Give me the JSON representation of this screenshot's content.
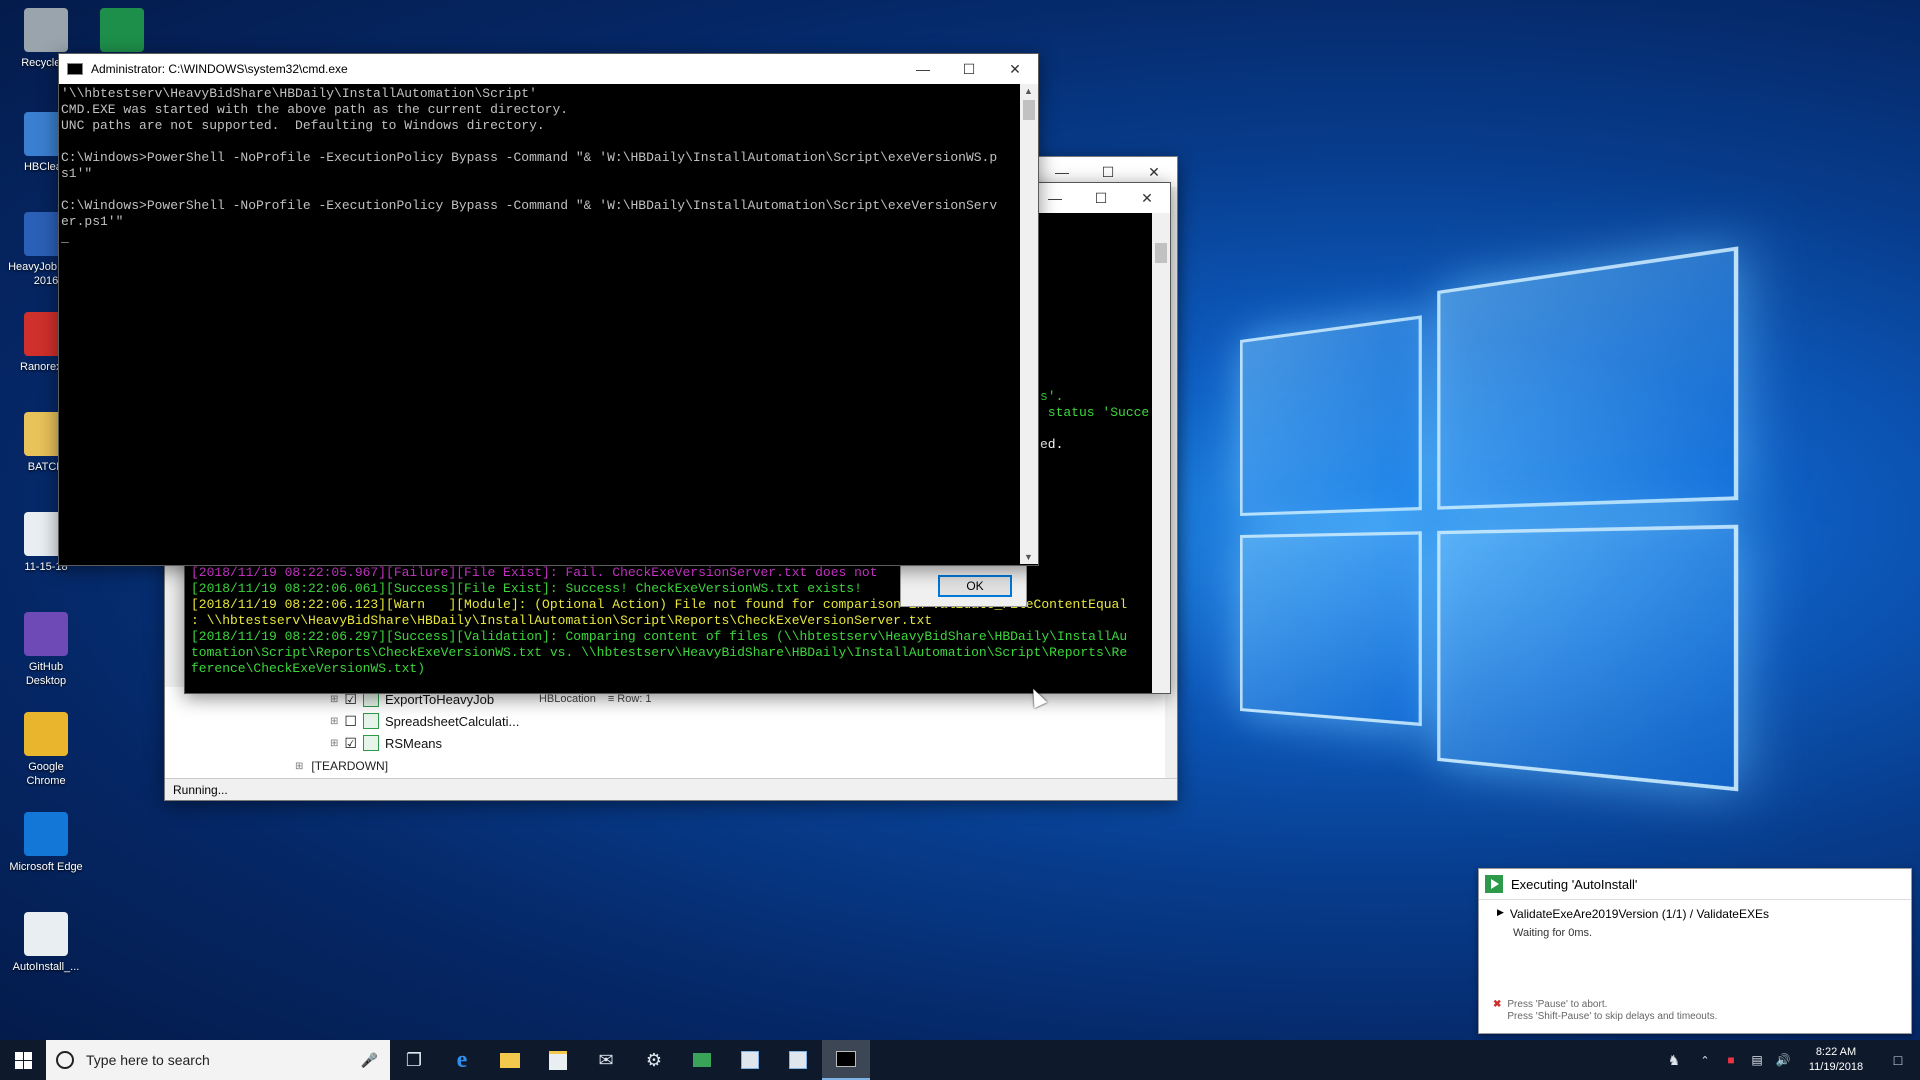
{
  "desktop": {
    "icons": [
      {
        "label": "Recycle B",
        "color": "#9aa4ad"
      },
      {
        "label": "",
        "color": "#1d8f4a"
      },
      {
        "label": "HBClean",
        "color": "#3a7fd0"
      },
      {
        "label": "HeavyJob Field 2016",
        "color": "#2b60b8"
      },
      {
        "label": "RanorexSt",
        "color": "#d0302b"
      },
      {
        "label": "BATCH",
        "color": "#e8c25a"
      },
      {
        "label": "11-15-18",
        "color": "#e9eef2"
      },
      {
        "label": "GitHub Desktop",
        "color": "#6e4ab6"
      },
      {
        "label": "Google Chrome",
        "color": "#e8b52c"
      },
      {
        "label": "Microsoft Edge",
        "color": "#1277d6"
      },
      {
        "label": "AutoInstall_...",
        "color": "#e9eef2"
      }
    ]
  },
  "cmd": {
    "title": "Administrator: C:\\WINDOWS\\system32\\cmd.exe",
    "lines": [
      "'\\\\hbtestserv\\HeavyBidShare\\HBDaily\\InstallAutomation\\Script'",
      "CMD.EXE was started with the above path as the current directory.",
      "UNC paths are not supported.  Defaulting to Windows directory.",
      "",
      "C:\\Windows>PowerShell -NoProfile -ExecutionPolicy Bypass -Command \"& 'W:\\HBDaily\\InstallAutomation\\Script\\exeVersionWS.p",
      "s1'\"",
      "",
      "C:\\Windows>PowerShell -NoProfile -ExecutionPolicy Bypass -Command \"& 'W:\\HBDaily\\InstallAutomation\\Script\\exeVersionServ",
      "er.ps1'\"",
      "_"
    ]
  },
  "ranorex": {
    "partial_lines": [
      {
        "text": "s'.",
        "color": "#3cd63c"
      },
      {
        "text": " status 'Succe",
        "color": "#3cd63c"
      },
      {
        "text": "",
        "color": "#3cd63c"
      },
      {
        "text": "ed.",
        "color": "#ffffff"
      }
    ],
    "log_lines": [
      {
        "text": "[2018/11/19 08:22:05.967][Failure][File Exist]: Fail. CheckExeVersionServer.txt does not",
        "color": "#e83ce8"
      },
      {
        "text": "[2018/11/19 08:22:06.061][Success][File Exist]: Success! CheckExeVersionWS.txt exists!",
        "color": "#3cd63c"
      },
      {
        "text": "[2018/11/19 08:22:06.123][Warn   ][Module]: (Optional Action) File not found for comparison in Validate_FileContentEqual",
        "color": "#e6e63c"
      },
      {
        "text": ": \\\\hbtestserv\\HeavyBidShare\\HBDaily\\InstallAutomation\\Script\\Reports\\CheckExeVersionServer.txt",
        "color": "#e6e63c"
      },
      {
        "text": "[2018/11/19 08:22:06.297][Success][Validation]: Comparing content of files (\\\\hbtestserv\\HeavyBidShare\\HBDaily\\InstallAu",
        "color": "#3cd63c"
      },
      {
        "text": "tomation\\Script\\Reports\\CheckExeVersionWS.txt vs. \\\\hbtestserv\\HeavyBidShare\\HBDaily\\InstallAutomation\\Script\\Reports\\Re",
        "color": "#3cd63c"
      },
      {
        "text": "ference\\CheckExeVersionWS.txt)",
        "color": "#3cd63c"
      }
    ],
    "ok_label": "OK",
    "tree": [
      {
        "label": "ExportToHeavyJob",
        "checked": true,
        "extra1": "HBLocation",
        "extra2": "Row: 1"
      },
      {
        "label": "SpreadsheetCalculati...",
        "checked": false,
        "extra1": "",
        "extra2": ""
      },
      {
        "label": "RSMeans",
        "checked": true,
        "extra1": "",
        "extra2": ""
      }
    ],
    "teardown_label": "[TEARDOWN]",
    "status": "Running..."
  },
  "progress": {
    "title": "Executing 'AutoInstall'",
    "item": "ValidateExeAre2019Version (1/1) / ValidateEXEs",
    "waiting": "Waiting for 0ms.",
    "hint1": "Press 'Pause' to abort.",
    "hint2": "Press 'Shift-Pause' to skip delays and timeouts."
  },
  "taskbar": {
    "search_placeholder": "Type here to search",
    "time": "8:22 AM",
    "date": "11/19/2018"
  }
}
